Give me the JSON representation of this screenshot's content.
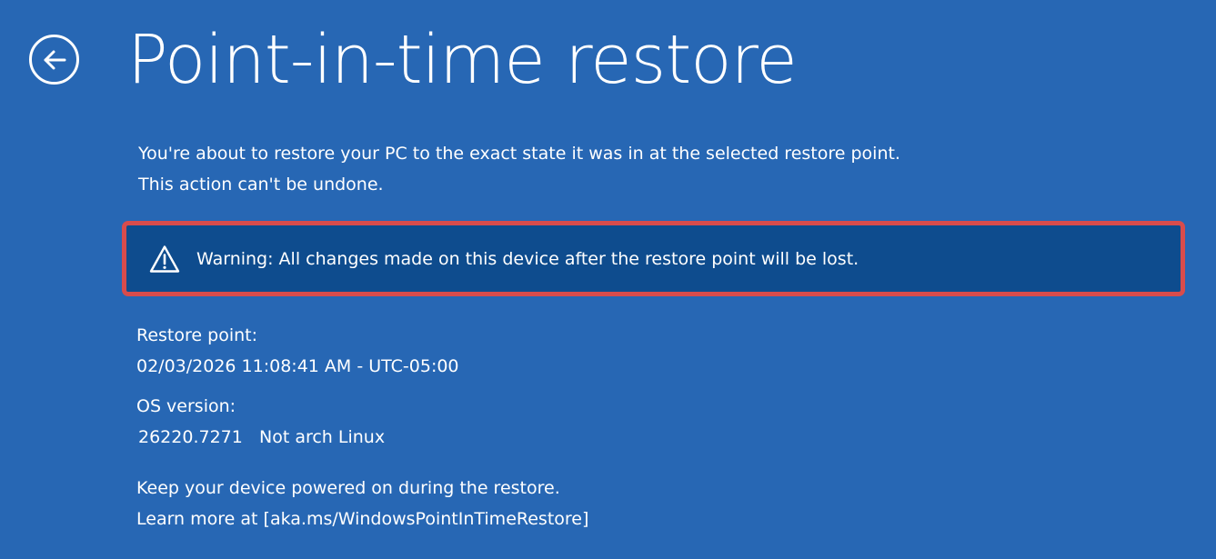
{
  "header": {
    "title": "Point-in-time restore",
    "back_icon": "back-arrow-icon"
  },
  "intro": {
    "line1": "You're about to restore your PC to the exact state it was in at the selected restore point.",
    "line2": "This action can't be undone."
  },
  "warning": {
    "icon": "warning-triangle-icon",
    "text": "Warning: All changes made on this device after the restore point will be lost.",
    "border_color": "#d84c4c",
    "background_color": "#0e4c8e"
  },
  "restore_point": {
    "label": "Restore point:",
    "value": "02/03/2026 11:08:41 AM - UTC-05:00"
  },
  "os_version": {
    "label": "OS version:",
    "build": "26220.7271",
    "name": "Not arch Linux"
  },
  "footer": {
    "line1": "Keep your device powered on during the restore.",
    "line2": "Learn more at [aka.ms/WindowsPointInTimeRestore]"
  },
  "colors": {
    "background": "#2767b4",
    "text": "#ffffff"
  }
}
